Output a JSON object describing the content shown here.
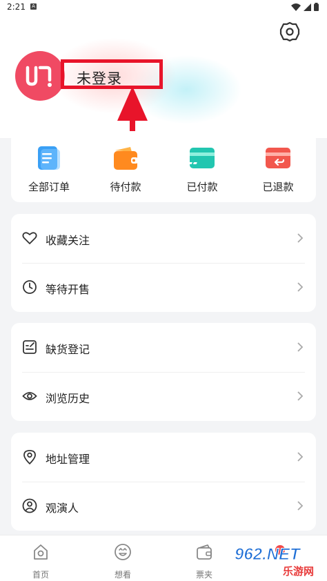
{
  "status_bar": {
    "time": "2:21",
    "notif_icon": "A"
  },
  "header": {
    "login_text": "未登录"
  },
  "orders": [
    {
      "label": "全部订单",
      "icon": "document-icon",
      "color": "#3aa0f5"
    },
    {
      "label": "待付款",
      "icon": "wallet-icon",
      "color": "#ff8a1f"
    },
    {
      "label": "已付款",
      "icon": "card-icon",
      "color": "#22c6b0"
    },
    {
      "label": "已退款",
      "icon": "refund-icon",
      "color": "#f2574d"
    }
  ],
  "list_group_1": [
    {
      "label": "收藏关注",
      "icon": "heart-icon"
    },
    {
      "label": "等待开售",
      "icon": "clock-icon"
    }
  ],
  "list_group_2": [
    {
      "label": "缺货登记",
      "icon": "register-icon"
    },
    {
      "label": "浏览历史",
      "icon": "eye-icon"
    }
  ],
  "list_group_3": [
    {
      "label": "地址管理",
      "icon": "location-icon"
    },
    {
      "label": "观演人",
      "icon": "person-icon"
    }
  ],
  "bottom_nav": [
    {
      "label": "首页",
      "icon": "home-icon"
    },
    {
      "label": "想看",
      "icon": "smile-icon"
    },
    {
      "label": "票夹",
      "icon": "ticket-wallet-icon"
    }
  ],
  "watermark": {
    "brand": "962.NET",
    "subtitle": "乐游网"
  }
}
